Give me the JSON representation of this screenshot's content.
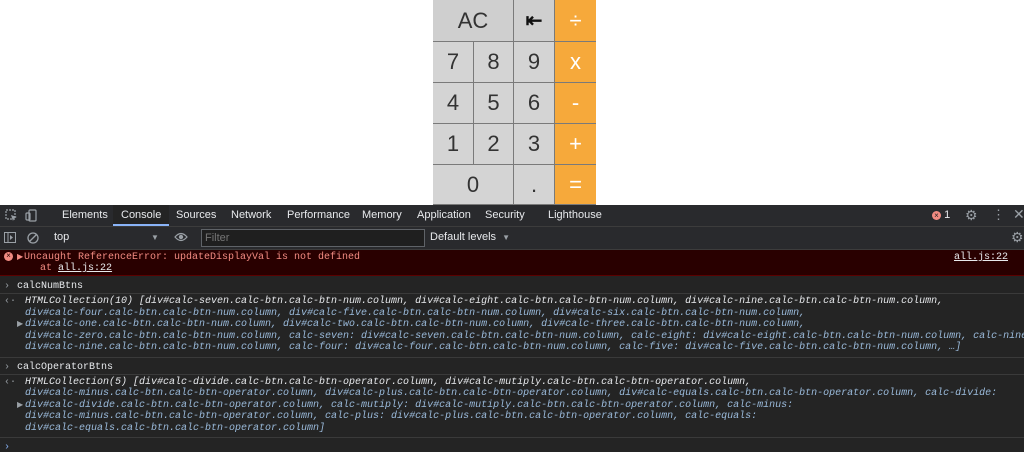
{
  "calculator": {
    "rows": [
      [
        {
          "label": "AC",
          "kind": "fn",
          "wide": true
        },
        {
          "label": "⇤",
          "kind": "fn"
        },
        {
          "label": "÷",
          "kind": "op"
        }
      ],
      [
        {
          "label": "7",
          "kind": "num"
        },
        {
          "label": "8",
          "kind": "num"
        },
        {
          "label": "9",
          "kind": "num"
        },
        {
          "label": "x",
          "kind": "op"
        }
      ],
      [
        {
          "label": "4",
          "kind": "num"
        },
        {
          "label": "5",
          "kind": "num"
        },
        {
          "label": "6",
          "kind": "num"
        },
        {
          "label": "-",
          "kind": "op"
        }
      ],
      [
        {
          "label": "1",
          "kind": "num"
        },
        {
          "label": "2",
          "kind": "num"
        },
        {
          "label": "3",
          "kind": "num"
        },
        {
          "label": "+",
          "kind": "op"
        }
      ],
      [
        {
          "label": "0",
          "kind": "num",
          "wide": true
        },
        {
          "label": ".",
          "kind": "num"
        },
        {
          "label": "=",
          "kind": "op"
        }
      ]
    ],
    "colors": {
      "operator": "#f6a93b",
      "number": "#d4d4d4",
      "border": "#7a7a7a"
    }
  },
  "devtools": {
    "tabs": [
      "Elements",
      "Console",
      "Sources",
      "Network",
      "Performance",
      "Memory",
      "Application",
      "Security",
      "Lighthouse"
    ],
    "active_tab": "Console",
    "error_count": "1",
    "context": "top",
    "filter_placeholder": "Filter",
    "levels": "Default levels",
    "error": {
      "message": "Uncaught ReferenceError: updateDisplayVal is not defined",
      "at_prefix": "at ",
      "location": "all.js:22",
      "source": "all.js:22"
    },
    "entries": [
      {
        "input": "calcNumBtns",
        "lines": [
          "HTMLCollection(10) [div#calc-seven.calc-btn.calc-btn-num.column, div#calc-eight.calc-btn.calc-btn-num.column, div#calc-nine.calc-btn.calc-btn-num.column,",
          "div#calc-four.calc-btn.calc-btn-num.column, div#calc-five.calc-btn.calc-btn-num.column, div#calc-six.calc-btn.calc-btn-num.column,",
          "div#calc-one.calc-btn.calc-btn-num.column, div#calc-two.calc-btn.calc-btn-num.column, div#calc-three.calc-btn.calc-btn-num.column,",
          "div#calc-zero.calc-btn.calc-btn-num.column, calc-seven: div#calc-seven.calc-btn.calc-btn-num.column, calc-eight: div#calc-eight.calc-btn.calc-btn-num.column, calc-nine:",
          "div#calc-nine.calc-btn.calc-btn-num.column, calc-four: div#calc-four.calc-btn.calc-btn-num.column, calc-five: div#calc-five.calc-btn.calc-btn-num.column, …]"
        ]
      },
      {
        "input": "calcOperatorBtns",
        "lines": [
          "HTMLCollection(5) [div#calc-divide.calc-btn.calc-btn-operator.column, div#calc-mutiply.calc-btn.calc-btn-operator.column,",
          "div#calc-minus.calc-btn.calc-btn-operator.column, div#calc-plus.calc-btn.calc-btn-operator.column, div#calc-equals.calc-btn.calc-btn-operator.column, calc-divide:",
          "div#calc-divide.calc-btn.calc-btn-operator.column, calc-mutiply: div#calc-mutiply.calc-btn.calc-btn-operator.column, calc-minus:",
          "div#calc-minus.calc-btn.calc-btn-operator.column, calc-plus: div#calc-plus.calc-btn.calc-btn-operator.column, calc-equals:",
          "div#calc-equals.calc-btn.calc-btn-operator.column]"
        ]
      }
    ]
  }
}
